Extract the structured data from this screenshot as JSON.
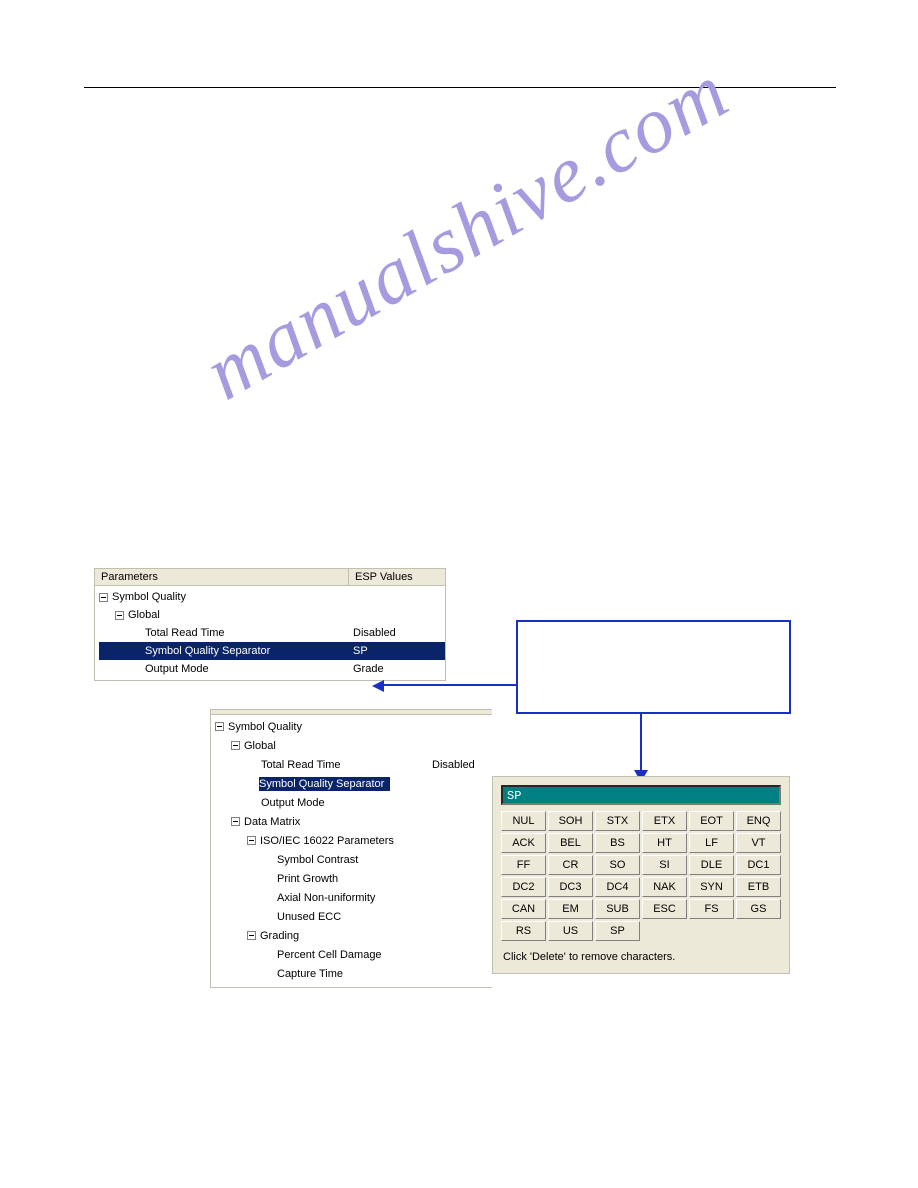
{
  "top_rule": true,
  "watermark": "manualshive.com",
  "tree1": {
    "headers": {
      "parameters": "Parameters",
      "values": "ESP Values"
    },
    "nodes": [
      {
        "label": "Symbol Quality",
        "level": 0,
        "expand": true
      },
      {
        "label": "Global",
        "level": 1,
        "expand": true
      },
      {
        "label": "Total Read Time",
        "level": 2,
        "value": "Disabled"
      },
      {
        "label": "Symbol Quality Separator",
        "level": 2,
        "value": "SP",
        "selected": true
      },
      {
        "label": "Output Mode",
        "level": 2,
        "value": "Grade"
      }
    ]
  },
  "tree2": {
    "header_blank": "",
    "right_value": "Disabled",
    "nodes": [
      {
        "label": "Symbol Quality",
        "level": 0,
        "expand": true
      },
      {
        "label": "Global",
        "level": 1,
        "expand": true
      },
      {
        "label": "Total Read Time",
        "level": 2,
        "value": "Disabled"
      },
      {
        "label": "Symbol Quality Separator",
        "level": 2,
        "selected": true
      },
      {
        "label": "Output Mode",
        "level": 2
      },
      {
        "label": "Data Matrix",
        "level": 1,
        "expand": true
      },
      {
        "label": "ISO/IEC 16022 Parameters",
        "level": 2,
        "expand": true
      },
      {
        "label": "Symbol Contrast",
        "level": 3
      },
      {
        "label": "Print Growth",
        "level": 3
      },
      {
        "label": "Axial Non-uniformity",
        "level": 3
      },
      {
        "label": "Unused ECC",
        "level": 3
      },
      {
        "label": "Grading",
        "level": 2,
        "expand": true
      },
      {
        "label": "Percent Cell Damage",
        "level": 3
      },
      {
        "label": "Capture Time",
        "level": 3
      }
    ]
  },
  "ascii": {
    "current": "SP",
    "buttons": [
      "NUL",
      "SOH",
      "STX",
      "ETX",
      "EOT",
      "ENQ",
      "ACK",
      "BEL",
      "BS",
      "HT",
      "LF",
      "VT",
      "FF",
      "CR",
      "SO",
      "SI",
      "DLE",
      "DC1",
      "DC2",
      "DC3",
      "DC4",
      "NAK",
      "SYN",
      "ETB",
      "CAN",
      "EM",
      "SUB",
      "ESC",
      "FS",
      "GS",
      "RS",
      "US",
      "SP",
      "",
      "",
      ""
    ],
    "hint": "Click 'Delete' to remove characters."
  }
}
